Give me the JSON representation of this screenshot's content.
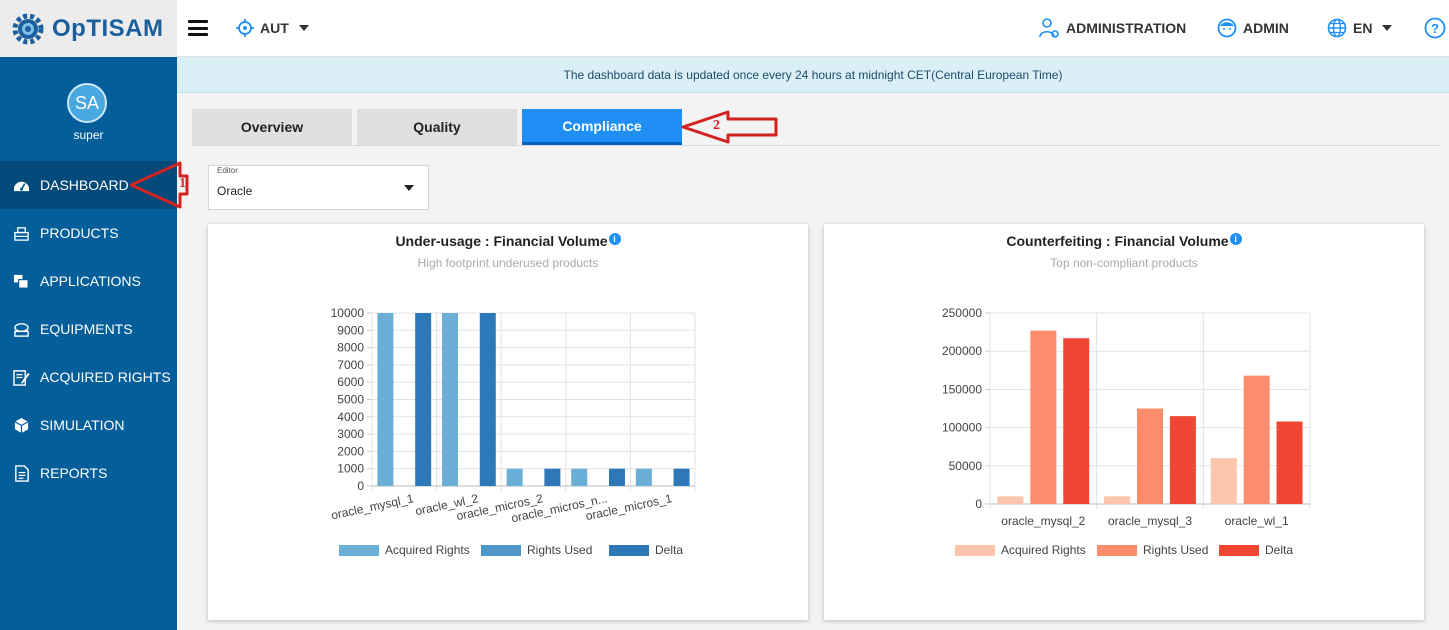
{
  "app": {
    "name": "OpTISAM"
  },
  "header": {
    "scope": "AUT",
    "administration": "ADMINISTRATION",
    "admin": "ADMIN",
    "language": "EN",
    "help": "?"
  },
  "user": {
    "initials": "SA",
    "name": "super"
  },
  "sidebar": {
    "items": [
      {
        "label": "DASHBOARD",
        "icon": "dashboard-icon"
      },
      {
        "label": "PRODUCTS",
        "icon": "products-icon"
      },
      {
        "label": "APPLICATIONS",
        "icon": "applications-icon"
      },
      {
        "label": "EQUIPMENTS",
        "icon": "equipments-icon"
      },
      {
        "label": "ACQUIRED RIGHTS",
        "icon": "acquired-rights-icon"
      },
      {
        "label": "SIMULATION",
        "icon": "simulation-icon"
      },
      {
        "label": "REPORTS",
        "icon": "reports-icon"
      }
    ]
  },
  "banner": {
    "text": "The dashboard data is updated once every 24 hours at midnight CET(Central European Time)"
  },
  "tabs": [
    {
      "label": "Overview"
    },
    {
      "label": "Quality"
    },
    {
      "label": "Compliance"
    }
  ],
  "editor": {
    "label": "Editor",
    "value": "Oracle"
  },
  "annotations": [
    "1",
    "2"
  ],
  "colors": {
    "sidebar": "#045e99",
    "active_tab": "#1f8ff5",
    "blue_series": [
      "#6baed6",
      "#4f96c9",
      "#2f78b7"
    ],
    "red_series": [
      "#fcc5ac",
      "#fc8c6b",
      "#ef4734"
    ],
    "annotation": "#d22222"
  },
  "chart_data": [
    {
      "type": "bar",
      "title": "Under-usage : Financial Volume",
      "subtitle": "High footprint underused products",
      "categories": [
        "oracle_mysql_1",
        "oracle_wl_2",
        "oracle_micros_2",
        "oracle_micros_n...",
        "oracle_micros_1"
      ],
      "series": [
        {
          "name": "Acquired Rights",
          "values": [
            10000,
            10000,
            1000,
            1000,
            1000
          ]
        },
        {
          "name": "Rights Used",
          "values": [
            0,
            0,
            0,
            0,
            0
          ]
        },
        {
          "name": "Delta",
          "values": [
            10000,
            10000,
            1000,
            1000,
            1000
          ]
        }
      ],
      "ylim": [
        0,
        10000
      ],
      "yticks": [
        0,
        1000,
        2000,
        3000,
        4000,
        5000,
        6000,
        7000,
        8000,
        9000,
        10000
      ],
      "grid": true,
      "legend": "bottom"
    },
    {
      "type": "bar",
      "title": "Counterfeiting : Financial Volume",
      "subtitle": "Top non-compliant products",
      "categories": [
        "oracle_mysql_2",
        "oracle_mysql_3",
        "oracle_wl_1"
      ],
      "series": [
        {
          "name": "Acquired Rights",
          "values": [
            10000,
            10000,
            60000
          ]
        },
        {
          "name": "Rights Used",
          "values": [
            227000,
            125000,
            168000
          ]
        },
        {
          "name": "Delta",
          "values": [
            217000,
            115000,
            108000
          ]
        }
      ],
      "ylim": [
        0,
        250000
      ],
      "yticks": [
        0,
        50000,
        100000,
        150000,
        200000,
        250000
      ],
      "grid": true,
      "legend": "bottom"
    }
  ]
}
